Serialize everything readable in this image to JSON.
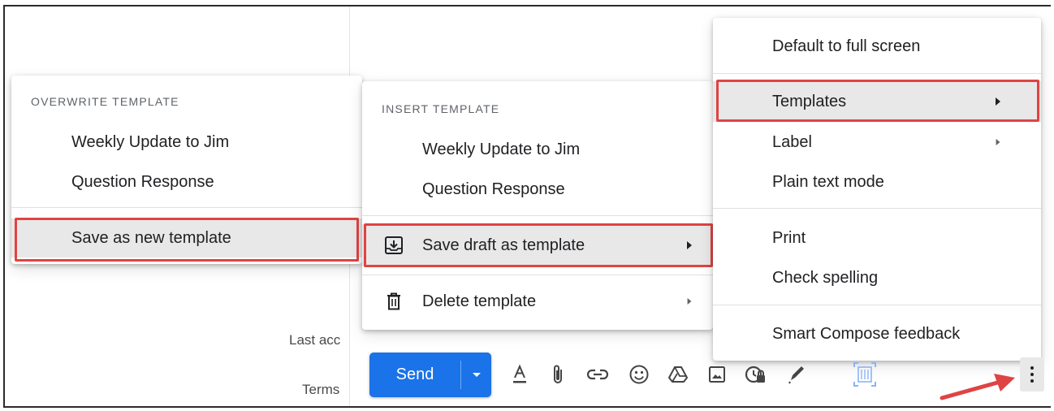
{
  "footer": {
    "last_account": "Last acc",
    "terms": "Terms"
  },
  "overwrite_menu": {
    "heading": "OVERWRITE TEMPLATE",
    "items": [
      "Weekly Update to Jim",
      "Question Response"
    ],
    "save_new": "Save as new template"
  },
  "insert_menu": {
    "heading": "INSERT TEMPLATE",
    "items": [
      "Weekly Update to Jim",
      "Question Response"
    ],
    "save_draft": "Save draft as template",
    "delete": "Delete template"
  },
  "more_menu": {
    "full_screen": "Default to full screen",
    "templates": "Templates",
    "label": "Label",
    "plain_text": "Plain text mode",
    "print": "Print",
    "check_spelling": "Check spelling",
    "smart_compose": "Smart Compose feedback"
  },
  "toolbar": {
    "send": "Send",
    "icons": [
      "format-text-icon",
      "attach-icon",
      "link-icon",
      "emoji-icon",
      "drive-icon",
      "photo-icon",
      "confidential-icon",
      "signature-icon",
      "layout-icon",
      "more-options-icon"
    ]
  },
  "colors": {
    "accent": "#1a73e8",
    "highlight_box": "#e04343",
    "arrow": "#e04343",
    "menu_highlight": "#e8e8e8"
  }
}
